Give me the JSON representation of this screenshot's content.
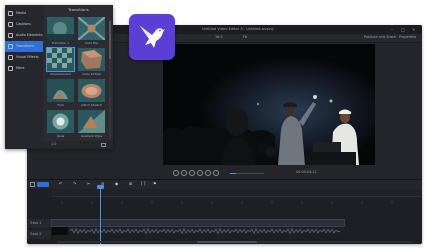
{
  "app": {
    "title": "Untitled Video Editor 3 - Untitled.wvproj",
    "logo_icon": "hummingbird-icon",
    "accent_color": "#4d8ee8",
    "logo_color": "#5b3fd4"
  },
  "toolbar": {
    "aspect_label": "16:9",
    "zoom_label": "Fit",
    "produce_label": "Produce and Share",
    "properties_label": "Properties"
  },
  "sidebar": {
    "items": [
      {
        "label": "Media",
        "icon": "media-icon"
      },
      {
        "label": "Captions",
        "icon": "captions-icon"
      },
      {
        "label": "Audio Elements",
        "icon": "audio-icon"
      },
      {
        "label": "Transitions",
        "icon": "transitions-icon",
        "active": true
      },
      {
        "label": "Visual Effects",
        "icon": "effects-icon"
      },
      {
        "label": "More",
        "icon": "more-icon"
      }
    ]
  },
  "transitions": {
    "title": "Transitions",
    "items": [
      {
        "label": "Transition 1"
      },
      {
        "label": "Card Flip"
      },
      {
        "label": "Checkerboard"
      },
      {
        "label": "Cube Rotate"
      },
      {
        "label": "Fold"
      },
      {
        "label": "Glitch Stretch"
      },
      {
        "label": "Glow"
      },
      {
        "label": "Gradient Wipe"
      },
      {
        "label": "Iris"
      },
      {
        "label": "Pop Out"
      }
    ],
    "footer_value": "1.0"
  },
  "playback": {
    "timecode": "00:00:04;12",
    "progress": 0.18
  },
  "timeline": {
    "tracks": [
      {
        "label": "Track 1"
      },
      {
        "label": "Track 2"
      }
    ]
  }
}
